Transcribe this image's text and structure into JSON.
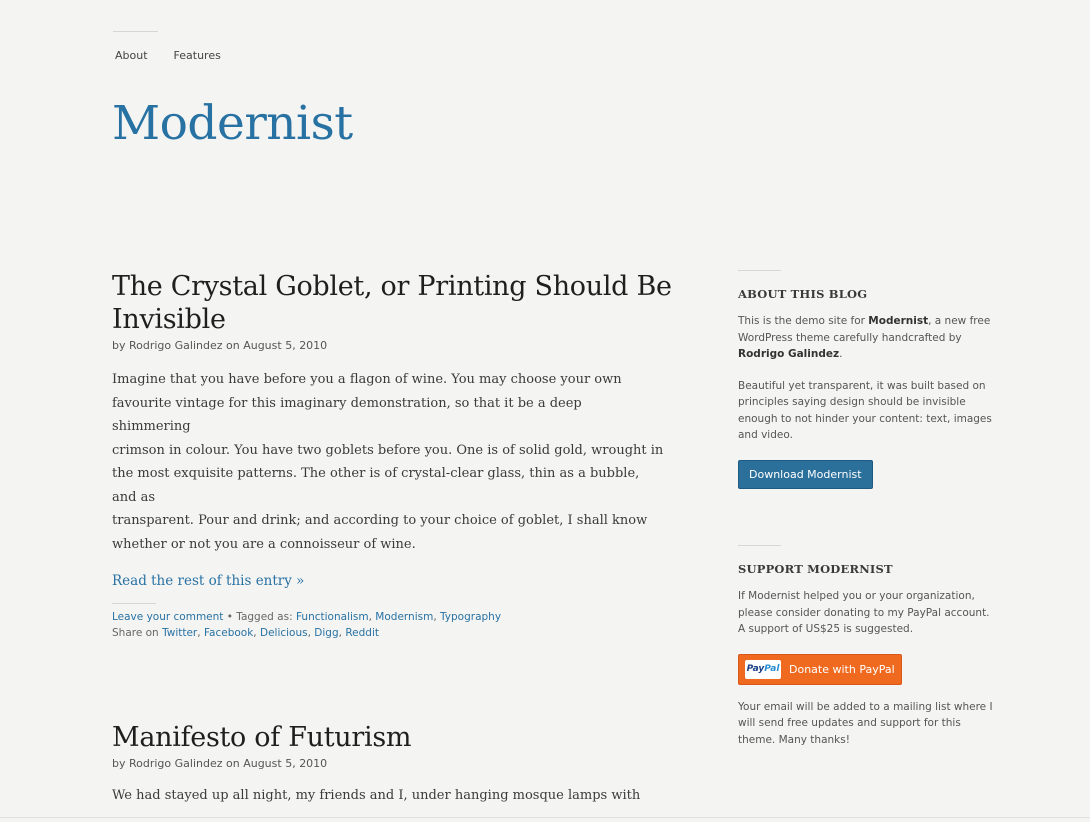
{
  "nav": {
    "items": [
      "About",
      "Features"
    ]
  },
  "site": {
    "title": "Modernist"
  },
  "posts": [
    {
      "title_line1": "The Crystal Goblet, or Printing Should Be",
      "title_line2": "Invisible",
      "byline": "by Rodrigo Galindez on August 5, 2010",
      "excerpt_lines": [
        "Imagine that you have before you a flagon of wine. You may choose your own",
        "favourite vintage for this imaginary demonstration, so that it be a deep shimmering",
        "crimson in colour. You have two goblets before you. One is of solid gold, wrought in",
        "the most exquisite patterns. The other is of crystal-clear glass, thin as a bubble, and as",
        "transparent. Pour and drink; and according to your choice of goblet, I shall know",
        "whether or not you are a connoisseur of wine."
      ],
      "read_more": "Read the rest of this entry »",
      "comment_link": "Leave your comment",
      "tagged_prefix": " • Tagged as: ",
      "tags": [
        "Functionalism",
        "Modernism",
        "Typography"
      ],
      "share_prefix": "Share on ",
      "share": [
        "Twitter",
        "Facebook",
        "Delicious",
        "Digg",
        "Reddit"
      ]
    },
    {
      "title": "Manifesto of Futurism",
      "byline": "by Rodrigo Galindez on August 5, 2010",
      "excerpt_line": "We had stayed up all night, my friends and I, under hanging mosque lamps with"
    }
  ],
  "sidebar": {
    "about": {
      "heading": "ABOUT THIS BLOG",
      "p1_a": "This is the demo site for ",
      "p1_name": "Modernist",
      "p1_b": ", a new free WordPress theme carefully handcrafted by ",
      "p1_author": "Rodrigo Galindez",
      "p1_c": ".",
      "p2": "Beautiful yet transparent, it was built based on principles saying design should be invisible enough to not hinder your content: text, images and video.",
      "button": "Download Modernist"
    },
    "support": {
      "heading": "SUPPORT MODERNIST",
      "p1": "If Modernist helped you or your organization, please consider donating to my PayPal account. A support of US$25 is suggested.",
      "paypal_badge_a": "Pay",
      "paypal_badge_b": "Pal",
      "button": "Donate with PayPal",
      "p2": "Your email will be added to a mailing list where I will send free updates and support for this theme. Many thanks!"
    }
  },
  "colors": {
    "accent": "#2872a3",
    "paypal": "#ef6a1e",
    "background": "#f4f4f3"
  }
}
